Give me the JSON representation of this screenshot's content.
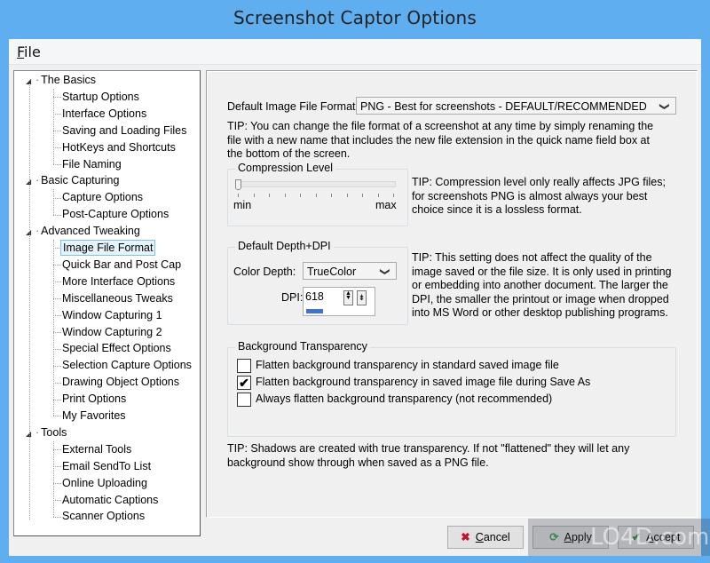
{
  "window": {
    "title": "Screenshot Captor Options"
  },
  "menu": {
    "file": {
      "accel": "F",
      "rest": "ile"
    }
  },
  "tree": {
    "groups": [
      {
        "label": "The Basics",
        "expander": "◢",
        "items": [
          "Startup Options",
          "Interface Options",
          "Saving and Loading Files",
          "HotKeys and Shortcuts",
          "File Naming"
        ]
      },
      {
        "label": "Basic Capturing",
        "expander": "◢",
        "items": [
          "Capture Options",
          "Post-Capture Options"
        ]
      },
      {
        "label": "Advanced Tweaking",
        "expander": "◢",
        "items": [
          "Image File Format",
          "Quick Bar and Post Cap",
          "More Interface Options",
          "Miscellaneous Tweaks",
          "Window Capturing 1",
          "Window Capturing 2",
          "Special Effect Options",
          "Selection Capture Options",
          "Drawing Object Options",
          "Print Options",
          "My Favorites"
        ]
      },
      {
        "label": "Tools",
        "expander": "◢",
        "items": [
          "External Tools",
          "Email SendTo List",
          "Online Uploading",
          "Automatic Captions",
          "Scanner Options"
        ]
      }
    ],
    "selected": "Image File Format"
  },
  "panel": {
    "format": {
      "label": "Default Image File Format:",
      "value": "PNG - Best for screenshots - DEFAULT/RECOMMENDED",
      "chevron": "❯",
      "tip_lines": [
        "TIP: You can change the file format of a screenshot at any time by simply renaming the",
        "file with a new name that includes the new file extension in the quick name field box at",
        "the bottom of the screen."
      ]
    },
    "compression": {
      "title": "Compression Level",
      "min_label": "min",
      "max_label": "max",
      "value": 0,
      "range": [
        0,
        10
      ],
      "tip_lines": [
        "TIP: Compression level only really affects JPG files;",
        "for screenshots PNG is almost always your best",
        "choice since it is a lossless format."
      ]
    },
    "depth": {
      "title": "Default Depth+DPI",
      "color_depth_label": "Color Depth:",
      "color_depth_value": "TrueColor",
      "dpi_label": "DPI:",
      "dpi_value": "618",
      "dpi_fill_fraction": 0.25,
      "tip_lines": [
        "TIP:  This setting does not affect the quality of the",
        "image saved or the file size.  It is only used in printing",
        "or embedding into another document.  The larger the",
        "DPI, the smaller the printout or image when dropped",
        "into MS Word or other desktop publishing programs."
      ]
    },
    "transparency": {
      "title": "Background Transparency",
      "options": [
        {
          "label": "Flatten background transparency in standard saved image file",
          "checked": false
        },
        {
          "label": "Flatten background transparency in saved image file during Save As",
          "checked": true
        },
        {
          "label": "Always flatten background transparency (not recommended)",
          "checked": false
        }
      ],
      "tip_lines": [
        "TIP: Shadows are created with true transparency.  If not \"flattened\" they will let any",
        "background show through when saved as a PNG file."
      ]
    }
  },
  "buttons": {
    "cancel": {
      "accel": "C",
      "rest": "ancel",
      "icon": "✖",
      "icon_color": "#c8102e"
    },
    "apply": {
      "accel": "A",
      "rest": "pply",
      "icon": "⟳",
      "icon_color": "#3aa655"
    },
    "accept": {
      "accel": "A",
      "rest": "ccept",
      "icon": "✔",
      "icon_color": "#2e8b2e"
    }
  },
  "watermark": {
    "text": "LO4D.com"
  }
}
